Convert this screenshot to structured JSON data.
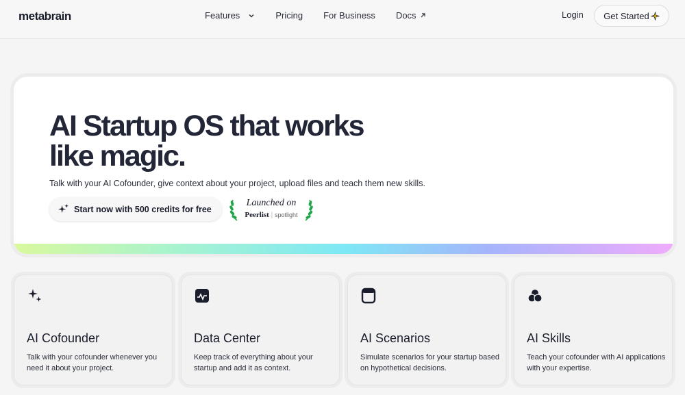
{
  "nav": {
    "logo": "metabrain",
    "links": [
      "Features",
      "Pricing",
      "For Business",
      "Docs"
    ],
    "login": "Login",
    "get_started": "Get Started"
  },
  "hero": {
    "title": "AI Startup OS that works like magic.",
    "subtitle": "Talk with your AI Cofounder, give context about your project, upload files and teach them new skills.",
    "cta": "Start now with 500 credits for free",
    "badge": {
      "launched": "Launched on",
      "brand": "Peerlist",
      "tag": "spotlight"
    }
  },
  "features": [
    {
      "title": "AI Cofounder",
      "desc": "Talk with your cofounder whenever you need it about your project.",
      "icon": "sparkles-icon"
    },
    {
      "title": "Data Center",
      "desc": "Keep track of everything about your startup and add it as context.",
      "icon": "chart-icon"
    },
    {
      "title": "AI Scenarios",
      "desc": "Simulate scenarios for your startup based on hypothetical decisions.",
      "icon": "window-icon"
    },
    {
      "title": "AI Skills",
      "desc": "Teach your cofounder with AI applications with your expertise.",
      "icon": "circles-icon"
    }
  ],
  "colors": {
    "text": "#1a1d2b",
    "gradient": [
      "#d9f99d",
      "#7ee8f5",
      "#a5b4fc",
      "#f0abfc"
    ],
    "laurel": "#22a54a"
  }
}
